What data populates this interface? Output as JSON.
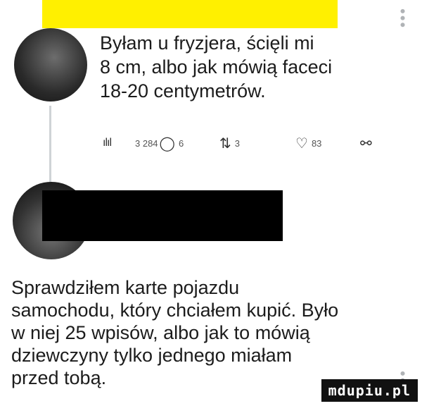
{
  "tweet1": {
    "text": "Byłam u fryzjera, ścięli mi\n8 cm, albo jak mówią faceci\n18-20 centymetrów.",
    "views": "3 284",
    "replies": "6",
    "retweets": "3",
    "likes": "83"
  },
  "tweet2": {
    "text": "Sprawdziłem karte pojazdu\nsamochodu, który chciałem kupić. Było\nw niej 25 wpisów, albo jak to mówią\ndziewczyny tylko jednego miałam\nprzed tobą."
  },
  "watermark": "mdupiu.pl",
  "colors": {
    "highlight": "#fff000",
    "redaction": "#000000"
  }
}
